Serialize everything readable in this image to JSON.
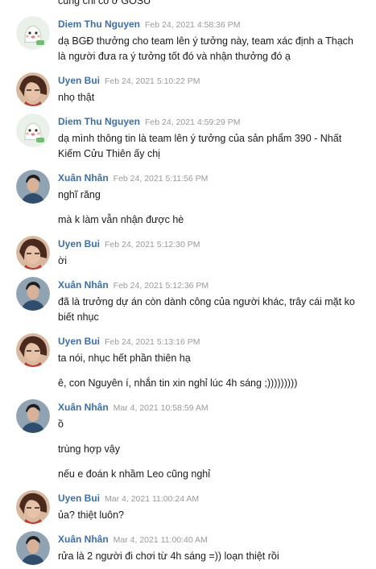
{
  "top_fragment": "cũng chỉ có ở GOSU",
  "messages": [
    {
      "author": "Diem Thu Nguyen",
      "time": "Feb 24, 2021 4:58:36 PM",
      "lines": [
        "dạ BGĐ thưởng cho team lên ý tưởng này, team xác định a Thạch",
        "là người đưa ra ý tưởng tốt đó và nhận thưởng đó ạ"
      ],
      "avatar": "ghost-avatar"
    },
    {
      "author": "Uyen Bui",
      "time": "Feb 24, 2021 5:10:22 PM",
      "lines": [
        "nhọ thật"
      ],
      "avatar": "woman-avatar"
    },
    {
      "author": "Diem Thu Nguyen",
      "time": "Feb 24, 2021 4:59:29 PM",
      "lines": [
        "dạ mình thông tin là team lên ý tưởng của sản phẩm 390 - Nhất",
        "Kiếm Cửu Thiên ấy chị"
      ],
      "avatar": "ghost-avatar"
    },
    {
      "author": "Xuân Nhân",
      "time": "Feb 24, 2021 5:11:56 PM",
      "lines": [
        "nghĩ răng"
      ],
      "extra": "mà k làm vẫn nhận được hè",
      "avatar": "man-avatar"
    },
    {
      "author": "Uyen Bui",
      "time": "Feb 24, 2021 5:12:30 PM",
      "lines": [
        "ời"
      ],
      "avatar": "woman-avatar"
    },
    {
      "author": "Xuân Nhân",
      "time": "Feb 24, 2021 5:12:36 PM",
      "lines": [
        "đã là trưởng dự án còn dành công của người khác, trây cái mặt ko",
        "biết nhục"
      ],
      "avatar": "man-avatar"
    },
    {
      "author": "Uyen Bui",
      "time": "Feb 24, 2021 5:13:16 PM",
      "lines": [
        "ta nói, nhục hết phần thiên hạ"
      ],
      "extra": "ê, con Nguyên í, nhắn tin xin nghỉ lúc 4h sáng ;)))))))))",
      "avatar": "woman-avatar"
    },
    {
      "author": "Xuân Nhân",
      "time": "Mar 4, 2021 10:58:59 AM",
      "lines": [
        "ồ"
      ],
      "extra": "trùng hợp vậy",
      "extra2": "nếu e đoán k nhầm Leo cũng nghỉ",
      "avatar": "man-avatar"
    },
    {
      "author": "Uyen Bui",
      "time": "Mar 4, 2021 11:00:24 AM",
      "lines": [
        "ủa? thiệt luôn?"
      ],
      "avatar": "woman-avatar"
    },
    {
      "author": "Xuân Nhân",
      "time": "Mar 4, 2021 11:00:40 AM",
      "lines": [
        "rửa là 2 người đi chơi từ 4h sáng =)) loạn thiệt rồi"
      ],
      "avatar": "man-avatar"
    }
  ]
}
